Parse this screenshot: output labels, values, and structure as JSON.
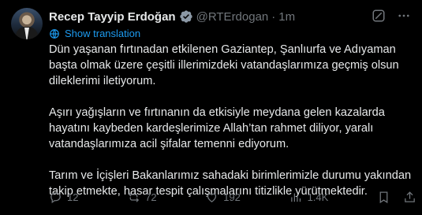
{
  "post": {
    "author_name": "Recep Tayyip Erdoğan",
    "handle": "@RTErdogan",
    "separator": "·",
    "time": "1m",
    "translate_label": "Show translation",
    "paragraphs": [
      "Dün yaşanan fırtınadan etkilenen Gaziantep, Şanlıurfa ve Adıyaman başta olmak üzere çeşitli illerimizdeki vatandaşlarımıza geçmiş olsun dileklerimi iletiyorum.",
      "Aşırı yağışların ve fırtınanın da etkisiyle meydana gelen kazalarda hayatını kaybeden kardeşlerimize Allah’tan rahmet diliyor, yaralı vatandaşlarımıza acil şifalar temenni ediyorum.",
      "Tarım ve İçişleri Bakanlarımız sahadaki birimlerimizle durumu yakından takip etmekte, hasar tespit çalışmalarını titizlikle yürütmektedir."
    ]
  },
  "actions": {
    "replies": "12",
    "reposts": "72",
    "likes": "192",
    "views": "1.4K"
  },
  "colors": {
    "background": "#000000",
    "text": "#e7e9ea",
    "muted": "#71767b",
    "accent": "#1d9bf0"
  },
  "icons": {
    "verified": "verified-badge-icon",
    "grok": "grok-icon",
    "more": "more-icon",
    "globe": "globe-icon",
    "reply": "reply-icon",
    "repost": "repost-icon",
    "like": "heart-icon",
    "views": "views-icon",
    "bookmark": "bookmark-icon",
    "share": "share-icon"
  }
}
